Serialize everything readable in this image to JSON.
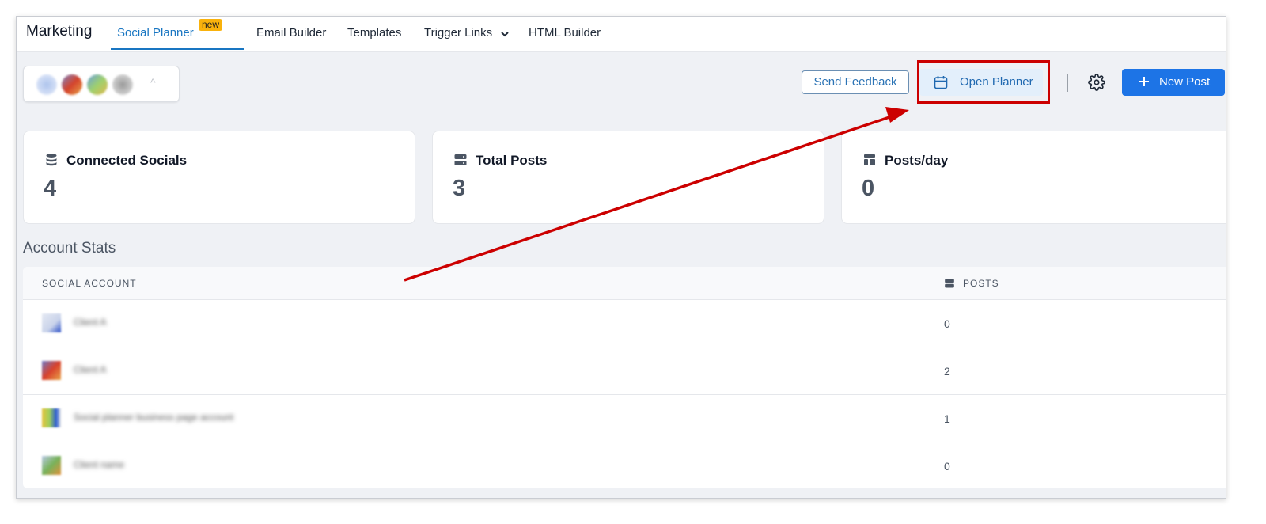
{
  "topnav": {
    "brand": "Marketing",
    "tabs": [
      {
        "label": "Social Planner",
        "badge": "new",
        "active": true
      },
      {
        "label": "Email Builder"
      },
      {
        "label": "Templates"
      },
      {
        "label": "Trigger Links"
      },
      {
        "label": "HTML Builder"
      }
    ]
  },
  "actions": {
    "send_feedback": "Send Feedback",
    "open_planner": "Open Planner",
    "new_post": "New Post"
  },
  "stats": [
    {
      "title": "Connected Socials",
      "value": "4",
      "icon": "database-icon"
    },
    {
      "title": "Total Posts",
      "value": "3",
      "icon": "server-icon"
    },
    {
      "title": "Posts/day",
      "value": "0",
      "icon": "layout-icon"
    }
  ],
  "account_stats": {
    "title": "Account Stats",
    "columns": [
      "SOCIAL ACCOUNT",
      "POSTS"
    ],
    "rows": [
      {
        "account": "Client A",
        "posts": "0"
      },
      {
        "account": "Client A",
        "posts": "2"
      },
      {
        "account": "Social planner business page account",
        "posts": "1"
      },
      {
        "account": "Client name",
        "posts": "0"
      }
    ]
  },
  "colors": {
    "accent": "#1976c2",
    "primary_button": "#1d74e6",
    "highlight": "#cc0000",
    "badge": "#f9b20c",
    "background": "#eff1f5"
  }
}
